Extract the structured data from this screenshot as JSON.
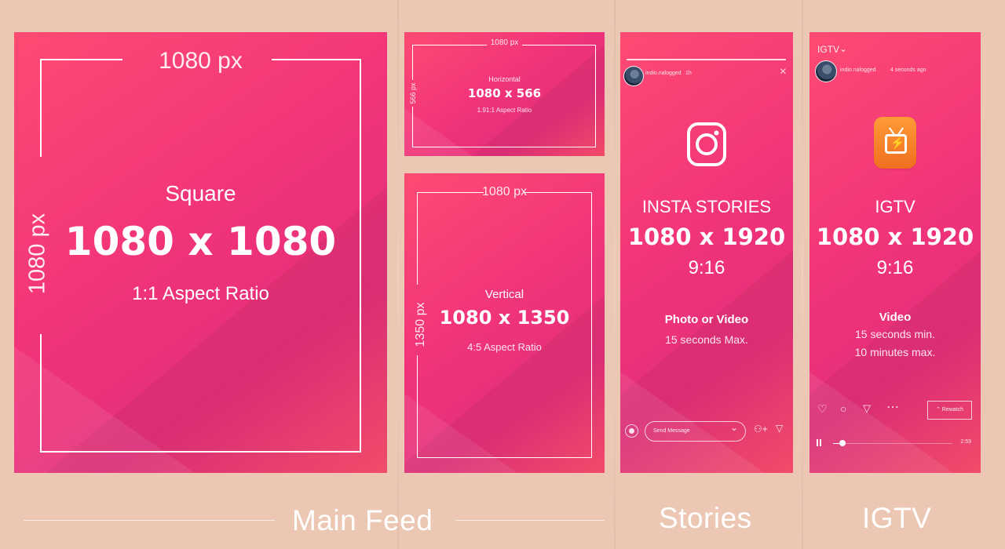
{
  "square": {
    "width_label": "1080 px",
    "height_label": "1080 px",
    "name": "Square",
    "size": "1080 x 1080",
    "ratio": "1:1 Aspect Ratio"
  },
  "horizontal": {
    "width_label": "1080 px",
    "height_label": "566 px",
    "name": "Horizontal",
    "size": "1080 x 566",
    "ratio": "1.91:1 Aspect Ratio"
  },
  "vertical": {
    "width_label": "1080 px",
    "height_label": "1350 px",
    "name": "Vertical",
    "size": "1080 x 1350",
    "ratio": "4:5 Aspect Ratio"
  },
  "stories": {
    "username": "indio.nalogged",
    "time": "1h",
    "title": "INSTA STORIES",
    "size": "1080 x 1920",
    "ratio": "9:16",
    "content_type": "Photo or Video",
    "duration": "15 seconds Max.",
    "message_placeholder": "Send Message",
    "label": "Stories"
  },
  "igtv": {
    "header": "IGTV",
    "username": "indio.nalogged",
    "time": "4 seconds ago",
    "title": "IGTV",
    "size": "1080 x 1920",
    "ratio": "9:16",
    "content_type": "Video",
    "min_duration": "15 seconds min.",
    "max_duration": "10 minutes max.",
    "action": "Rewatch",
    "time_remaining": "2:59",
    "progress": 0.08,
    "label": "IGTV"
  },
  "labels": {
    "main_feed": "Main Feed"
  },
  "colors": {
    "background": "#ecc7b4",
    "card_pink": "#f1347a",
    "igtv_orange": "#f58b2d"
  }
}
